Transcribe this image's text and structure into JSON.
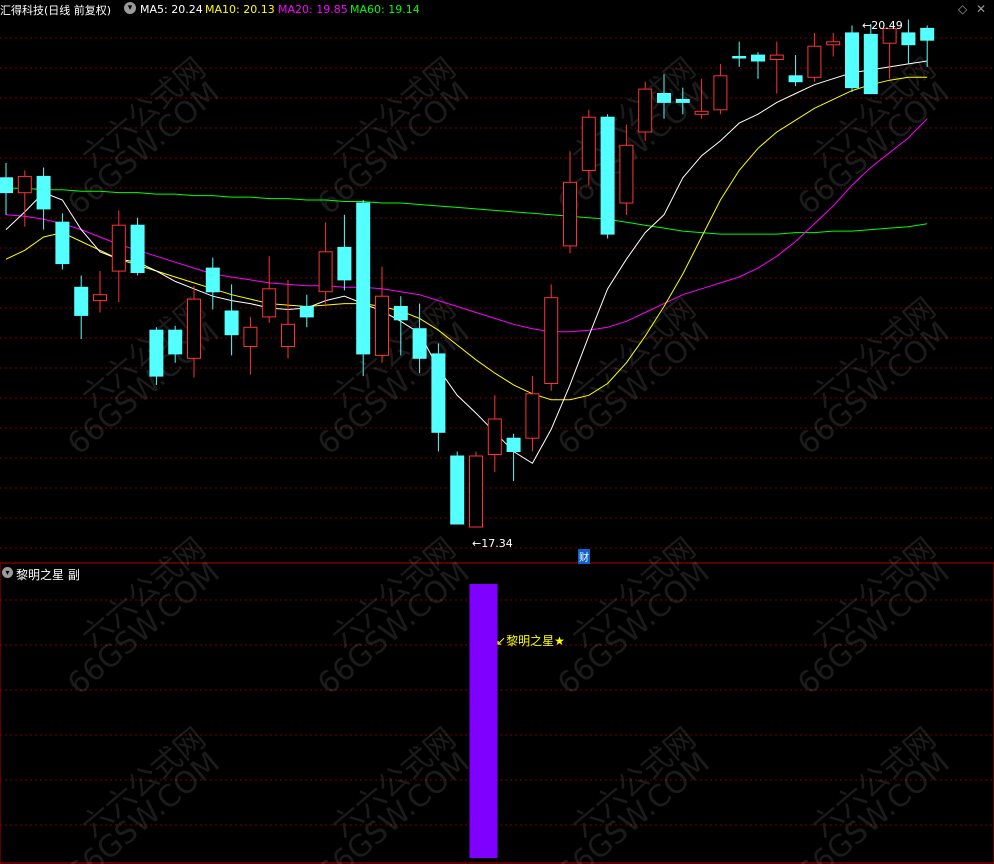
{
  "header": {
    "stock_title": "汇得科技(日线 前复权)",
    "ma5_label": "MA5: 20.24",
    "ma10_label": "MA10: 20.13",
    "ma20_label": "MA20: 19.85",
    "ma60_label": "MA60: 19.14"
  },
  "sub_panel": {
    "title": "黎明之星 副",
    "signal_label": "黎明之星★"
  },
  "annotations": {
    "high_label": "20.49",
    "low_label": "17.34",
    "finance_marker": "财"
  },
  "watermark": {
    "cn": "六六公式网",
    "en": "66GSW.COM"
  },
  "colors": {
    "up": "#ff3232",
    "down": "#54ffff",
    "ma5": "#ffffff",
    "ma10": "#ffff00",
    "ma20": "#ff00ff",
    "ma60": "#00ff00",
    "signal_bar": "#8000ff",
    "grid": "#7a0000"
  },
  "chart_data": {
    "type": "candlestick",
    "title": "汇得科技(日线 前复权)",
    "y_range": [
      17.2,
      20.6
    ],
    "highest": 20.49,
    "lowest": 17.34,
    "candles": [
      {
        "o": 19.45,
        "c": 19.35,
        "h": 19.55,
        "l": 19.2
      },
      {
        "o": 19.35,
        "c": 19.46,
        "h": 19.5,
        "l": 19.12
      },
      {
        "o": 19.46,
        "c": 19.24,
        "h": 19.52,
        "l": 19.1
      },
      {
        "o": 19.15,
        "c": 18.87,
        "h": 19.21,
        "l": 18.83
      },
      {
        "o": 18.71,
        "c": 18.52,
        "h": 18.79,
        "l": 18.36
      },
      {
        "o": 18.62,
        "c": 18.66,
        "h": 18.82,
        "l": 18.54
      },
      {
        "o": 18.82,
        "c": 19.13,
        "h": 19.23,
        "l": 18.61
      },
      {
        "o": 19.13,
        "c": 18.81,
        "h": 19.18,
        "l": 18.79
      },
      {
        "o": 18.42,
        "c": 18.11,
        "h": 18.44,
        "l": 18.05
      },
      {
        "o": 18.42,
        "c": 18.26,
        "h": 18.45,
        "l": 18.2
      },
      {
        "o": 18.23,
        "c": 18.63,
        "h": 18.72,
        "l": 18.1
      },
      {
        "o": 18.84,
        "c": 18.68,
        "h": 18.91,
        "l": 18.56
      },
      {
        "o": 18.55,
        "c": 18.39,
        "h": 18.73,
        "l": 18.25
      },
      {
        "o": 18.31,
        "c": 18.44,
        "h": 18.51,
        "l": 18.12
      },
      {
        "o": 18.51,
        "c": 18.7,
        "h": 18.92,
        "l": 18.47
      },
      {
        "o": 18.31,
        "c": 18.46,
        "h": 18.76,
        "l": 18.23
      },
      {
        "o": 18.58,
        "c": 18.51,
        "h": 18.66,
        "l": 18.44
      },
      {
        "o": 18.68,
        "c": 18.95,
        "h": 19.15,
        "l": 18.58
      },
      {
        "o": 18.98,
        "c": 18.76,
        "h": 19.2,
        "l": 18.69
      },
      {
        "o": 19.28,
        "c": 18.26,
        "h": 19.3,
        "l": 18.11
      },
      {
        "o": 18.25,
        "c": 18.65,
        "h": 18.85,
        "l": 18.2
      },
      {
        "o": 18.58,
        "c": 18.49,
        "h": 18.65,
        "l": 18.25
      },
      {
        "o": 18.43,
        "c": 18.23,
        "h": 18.6,
        "l": 18.13
      },
      {
        "o": 18.26,
        "c": 17.73,
        "h": 18.33,
        "l": 17.6
      },
      {
        "o": 17.57,
        "c": 17.11,
        "h": 17.6,
        "l": 17.11
      },
      {
        "o": 17.09,
        "c": 17.57,
        "h": 17.6,
        "l": 17.1
      },
      {
        "o": 17.58,
        "c": 17.82,
        "h": 17.98,
        "l": 17.46
      },
      {
        "o": 17.69,
        "c": 17.6,
        "h": 17.72,
        "l": 17.4
      },
      {
        "o": 17.69,
        "c": 17.99,
        "h": 18.11,
        "l": 17.6
      },
      {
        "o": 18.06,
        "c": 18.64,
        "h": 18.73,
        "l": 18.01
      },
      {
        "o": 18.99,
        "c": 19.42,
        "h": 19.63,
        "l": 18.94
      },
      {
        "o": 19.5,
        "c": 19.86,
        "h": 19.91,
        "l": 19.4
      },
      {
        "o": 19.86,
        "c": 19.07,
        "h": 19.88,
        "l": 19.04
      },
      {
        "o": 19.28,
        "c": 19.67,
        "h": 19.81,
        "l": 19.2
      },
      {
        "o": 19.76,
        "c": 20.05,
        "h": 20.1,
        "l": 19.7
      },
      {
        "o": 20.02,
        "c": 19.96,
        "h": 20.15,
        "l": 19.85
      },
      {
        "o": 19.98,
        "c": 19.96,
        "h": 20.06,
        "l": 19.88
      },
      {
        "o": 19.88,
        "c": 19.9,
        "h": 20.12,
        "l": 19.85
      },
      {
        "o": 19.91,
        "c": 20.14,
        "h": 20.22,
        "l": 19.88
      },
      {
        "o": 20.27,
        "c": 20.26,
        "h": 20.37,
        "l": 20.2
      },
      {
        "o": 20.28,
        "c": 20.24,
        "h": 20.3,
        "l": 20.12
      },
      {
        "o": 20.25,
        "c": 20.28,
        "h": 20.37,
        "l": 20.02
      },
      {
        "o": 20.14,
        "c": 20.1,
        "h": 20.28,
        "l": 20.07
      },
      {
        "o": 20.13,
        "c": 20.34,
        "h": 20.43,
        "l": 20.1
      },
      {
        "o": 20.35,
        "c": 20.37,
        "h": 20.43,
        "l": 20.27
      },
      {
        "o": 20.43,
        "c": 20.06,
        "h": 20.48,
        "l": 20.03
      },
      {
        "o": 20.42,
        "c": 20.02,
        "h": 20.49,
        "l": 20.05
      },
      {
        "o": 20.36,
        "c": 20.46,
        "h": 20.44,
        "l": 20.12
      },
      {
        "o": 20.43,
        "c": 20.35,
        "h": 20.52,
        "l": 20.22
      },
      {
        "o": 20.46,
        "c": 20.38,
        "h": 20.48,
        "l": 20.2
      }
    ],
    "ma5": [
      19.1,
      19.22,
      19.35,
      19.3,
      19.1,
      18.95,
      18.9,
      18.88,
      18.82,
      18.75,
      18.7,
      18.65,
      18.62,
      18.6,
      18.57,
      18.56,
      18.57,
      18.62,
      18.65,
      18.6,
      18.55,
      18.48,
      18.4,
      18.16,
      17.98,
      17.86,
      17.73,
      17.6,
      17.52,
      17.75,
      18.05,
      18.38,
      18.7,
      18.9,
      19.08,
      19.2,
      19.45,
      19.6,
      19.7,
      19.82,
      19.88,
      19.96,
      20.02,
      20.08,
      20.12,
      20.16,
      20.18,
      20.2,
      20.22,
      20.24
    ],
    "ma10": [
      18.9,
      18.96,
      19.05,
      19.08,
      19.02,
      18.96,
      18.9,
      18.86,
      18.82,
      18.78,
      18.74,
      18.7,
      18.66,
      18.63,
      18.6,
      18.59,
      18.58,
      18.59,
      18.6,
      18.6,
      18.58,
      18.55,
      18.5,
      18.42,
      18.32,
      18.22,
      18.13,
      18.05,
      17.99,
      17.95,
      17.95,
      17.98,
      18.06,
      18.2,
      18.38,
      18.58,
      18.8,
      19.05,
      19.3,
      19.5,
      19.65,
      19.76,
      19.84,
      19.92,
      19.98,
      20.04,
      20.08,
      20.11,
      20.13,
      20.13
    ],
    "ma20": [
      19.2,
      19.19,
      19.17,
      19.14,
      19.1,
      19.05,
      19.0,
      18.96,
      18.92,
      18.88,
      18.84,
      18.8,
      18.78,
      18.76,
      18.74,
      18.73,
      18.72,
      18.72,
      18.71,
      18.71,
      18.7,
      18.68,
      18.66,
      18.62,
      18.58,
      18.54,
      18.5,
      18.46,
      18.43,
      18.41,
      18.41,
      18.42,
      18.44,
      18.48,
      18.54,
      18.6,
      18.66,
      18.7,
      18.74,
      18.78,
      18.84,
      18.92,
      19.02,
      19.14,
      19.26,
      19.4,
      19.52,
      19.62,
      19.72,
      19.85
    ],
    "ma60": [
      19.38,
      19.38,
      19.37,
      19.37,
      19.36,
      19.36,
      19.35,
      19.35,
      19.34,
      19.34,
      19.33,
      19.33,
      19.32,
      19.32,
      19.31,
      19.31,
      19.3,
      19.3,
      19.29,
      19.29,
      19.28,
      19.28,
      19.27,
      19.26,
      19.25,
      19.24,
      19.23,
      19.22,
      19.21,
      19.2,
      19.19,
      19.18,
      19.17,
      19.15,
      19.13,
      19.11,
      19.09,
      19.08,
      19.07,
      19.07,
      19.07,
      19.07,
      19.08,
      19.08,
      19.09,
      19.09,
      19.1,
      19.11,
      19.12,
      19.14
    ],
    "signal_index": 25
  }
}
